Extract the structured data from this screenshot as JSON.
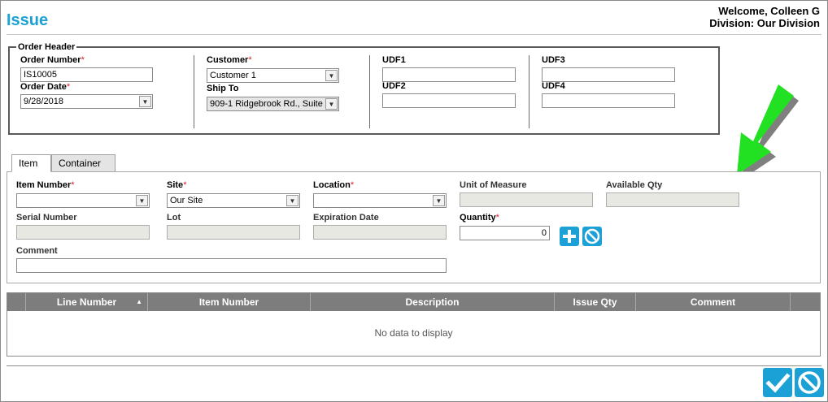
{
  "page": {
    "title": "Issue"
  },
  "header": {
    "welcome": "Welcome, Colleen G",
    "division": "Division: Our Division"
  },
  "order_header": {
    "legend": "Order Header",
    "order_number": {
      "label": "Order Number",
      "value": "IS10005"
    },
    "order_date": {
      "label": "Order Date",
      "value": "9/28/2018"
    },
    "customer": {
      "label": "Customer",
      "value": "Customer 1"
    },
    "ship_to": {
      "label": "Ship To",
      "value": "909-1 Ridgebrook Rd., Suite"
    },
    "udf1": {
      "label": "UDF1",
      "value": ""
    },
    "udf2": {
      "label": "UDF2",
      "value": ""
    },
    "udf3": {
      "label": "UDF3",
      "value": ""
    },
    "udf4": {
      "label": "UDF4",
      "value": ""
    }
  },
  "tabs": [
    {
      "label": "Item",
      "active": true
    },
    {
      "label": "Container",
      "active": false
    }
  ],
  "item_form": {
    "item_number": {
      "label": "Item Number",
      "value": ""
    },
    "site": {
      "label": "Site",
      "value": "Our Site"
    },
    "location": {
      "label": "Location",
      "value": ""
    },
    "unit_of_measure": {
      "label": "Unit of Measure",
      "value": ""
    },
    "available_qty": {
      "label": "Available Qty",
      "value": ""
    },
    "serial_number": {
      "label": "Serial Number",
      "value": ""
    },
    "lot": {
      "label": "Lot",
      "value": ""
    },
    "expiration_date": {
      "label": "Expiration Date",
      "value": ""
    },
    "quantity": {
      "label": "Quantity",
      "value": "0"
    },
    "comment": {
      "label": "Comment",
      "value": ""
    }
  },
  "grid": {
    "columns": [
      "Line Number",
      "Item Number",
      "Description",
      "Issue Qty",
      "Comment"
    ],
    "empty_text": "No data to display"
  },
  "icons": {
    "add": "plus-icon",
    "cancel_line": "cancel-icon",
    "submit": "check-icon",
    "cancel": "cancel-icon",
    "sort": "sort-ascending-icon",
    "annotation": "green-arrow-icon"
  },
  "colors": {
    "accent": "#1ba1d6",
    "required": "#e02020",
    "grid_header": "#7d7d7d",
    "annotation": "#22e022"
  }
}
